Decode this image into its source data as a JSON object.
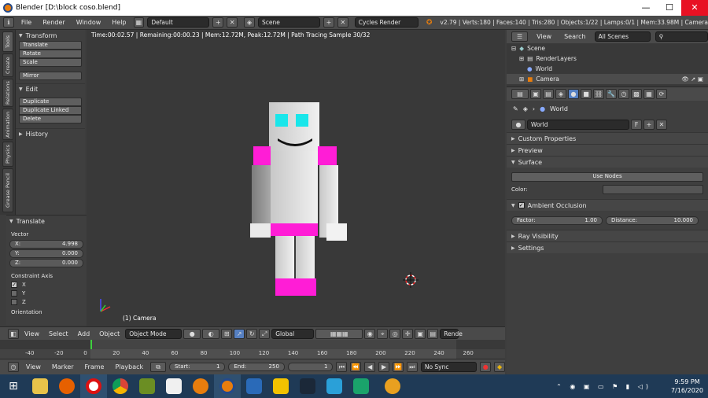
{
  "window": {
    "title": "Blender [D:\\block coso.blend]",
    "minimize": "—",
    "maximize": "☐",
    "close": "✕"
  },
  "menubar": {
    "items": [
      "File",
      "Render",
      "Window",
      "Help"
    ],
    "layout": "Default",
    "scene": "Scene",
    "engine": "Cycles Render",
    "stats": "v2.79 | Verts:180 | Faces:140 | Tris:280 | Objects:1/22 | Lamps:0/1 | Mem:33.98M | Camera"
  },
  "tabs": [
    "Tools",
    "Create",
    "Relations",
    "Animation",
    "Physics",
    "Grease Pencil"
  ],
  "toolshelf": {
    "transform_header": "Transform",
    "transform_buttons": [
      "Translate",
      "Rotate",
      "Scale"
    ],
    "mirror": "Mirror",
    "edit_header": "Edit",
    "edit_buttons": [
      "Duplicate",
      "Duplicate Linked",
      "Delete"
    ],
    "history_header": "History"
  },
  "redo": {
    "header": "Translate",
    "vector_label": "Vector",
    "x_label": "X:",
    "x_value": "4.998",
    "y_label": "Y:",
    "y_value": "0.000",
    "z_label": "Z:",
    "z_value": "0.000",
    "constraint_label": "Constraint Axis",
    "cx": "X",
    "cy": "Y",
    "cz": "Z",
    "orientation": "Orientation"
  },
  "viewport": {
    "info": "Time:00:02.57 | Remaining:00:00.23 | Mem:12.72M, Peak:12.72M | Path Tracing Sample 30/32",
    "camera_label": "(1) Camera"
  },
  "viewheader": {
    "items": [
      "View",
      "Select",
      "Add",
      "Object"
    ],
    "mode": "Object Mode",
    "orientation": "Global",
    "render": "Rende"
  },
  "timeline": {
    "ticks": [
      "-40",
      "-20",
      "0",
      "20",
      "40",
      "60",
      "80",
      "100",
      "120",
      "140",
      "160",
      "180",
      "200",
      "220",
      "240",
      "260"
    ],
    "menu": [
      "View",
      "Marker",
      "Frame",
      "Playback"
    ],
    "start_label": "Start:",
    "start": "1",
    "end_label": "End:",
    "end": "250",
    "current": "1",
    "sync": "No Sync"
  },
  "outliner": {
    "view": "View",
    "search": "Search",
    "filter": "All Scenes",
    "rows": [
      "Scene",
      "RenderLayers",
      "World",
      "Camera"
    ]
  },
  "properties": {
    "breadcrumb": "World",
    "world_name": "World",
    "fake_user": "F",
    "sections": [
      "Custom Properties",
      "Preview",
      "Surface"
    ],
    "use_nodes": "Use Nodes",
    "color_label": "Color:",
    "ao_header": "Ambient Occlusion",
    "factor_label": "Factor:",
    "factor": "1.00",
    "distance_label": "Distance:",
    "distance": "10.000",
    "ray_visibility": "Ray Visibility",
    "settings": "Settings"
  },
  "taskbar": {
    "time": "9:59 PM",
    "date": "7/16/2020"
  },
  "colors": {
    "pink": "#ff1dd6",
    "eye": "#19e6ea",
    "body": "#dcdcdc",
    "taskbar": "#1f3a56"
  }
}
